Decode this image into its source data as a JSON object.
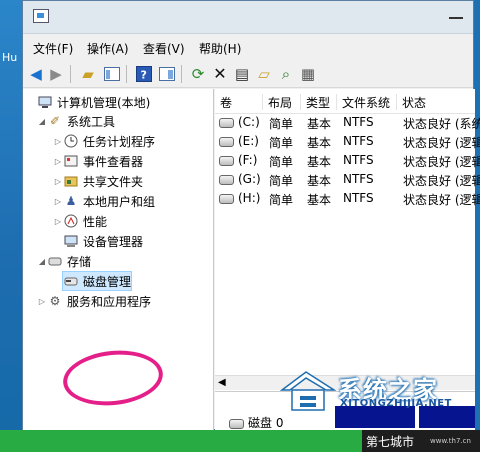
{
  "desktop": {
    "partial_label": "Hu"
  },
  "menubar": {
    "items": [
      "文件(F)",
      "操作(A)",
      "查看(V)",
      "帮助(H)"
    ]
  },
  "toolbar": {
    "icons": [
      "back-arrow-icon",
      "forward-arrow-icon",
      "up-folder-icon",
      "show-tree-icon",
      "help-icon",
      "console-icon",
      "refresh-icon",
      "delete-icon",
      "properties-icon",
      "open-folder-icon",
      "search-icon",
      "settings-icon"
    ]
  },
  "tree": {
    "root": "计算机管理(本地)",
    "system_tools": "系统工具",
    "task_scheduler": "任务计划程序",
    "event_viewer": "事件查看器",
    "shared_folders": "共享文件夹",
    "local_users": "本地用户和组",
    "performance": "性能",
    "device_manager": "设备管理器",
    "storage": "存储",
    "disk_management": "磁盘管理",
    "services_apps": "服务和应用程序"
  },
  "volumes": {
    "columns": [
      "卷",
      "布局",
      "类型",
      "文件系统",
      "状态"
    ],
    "rows": [
      {
        "name": "(C:)",
        "layout": "简单",
        "type": "基本",
        "fs": "NTFS",
        "status": "状态良好 (系统"
      },
      {
        "name": "(E:)",
        "layout": "简单",
        "type": "基本",
        "fs": "NTFS",
        "status": "状态良好 (逻辑"
      },
      {
        "name": "(F:)",
        "layout": "简单",
        "type": "基本",
        "fs": "NTFS",
        "status": "状态良好 (逻辑"
      },
      {
        "name": "(G:)",
        "layout": "简单",
        "type": "基本",
        "fs": "NTFS",
        "status": "状态良好 (逻辑"
      },
      {
        "name": "(H:)",
        "layout": "简单",
        "type": "基本",
        "fs": "NTFS",
        "status": "状态良好 (逻辑"
      }
    ]
  },
  "disk_area": {
    "disk_label": "磁盘 0"
  },
  "watermark": {
    "brand": "系统之家",
    "url": "XITONGZHIJIA.NET"
  },
  "footer": {
    "site": "第七城市",
    "url": "www.th7.cn"
  },
  "colors": {
    "highlight_ring": "#e41f8a",
    "partition_bar": "#06158f",
    "footer_green": "#27ab42"
  }
}
